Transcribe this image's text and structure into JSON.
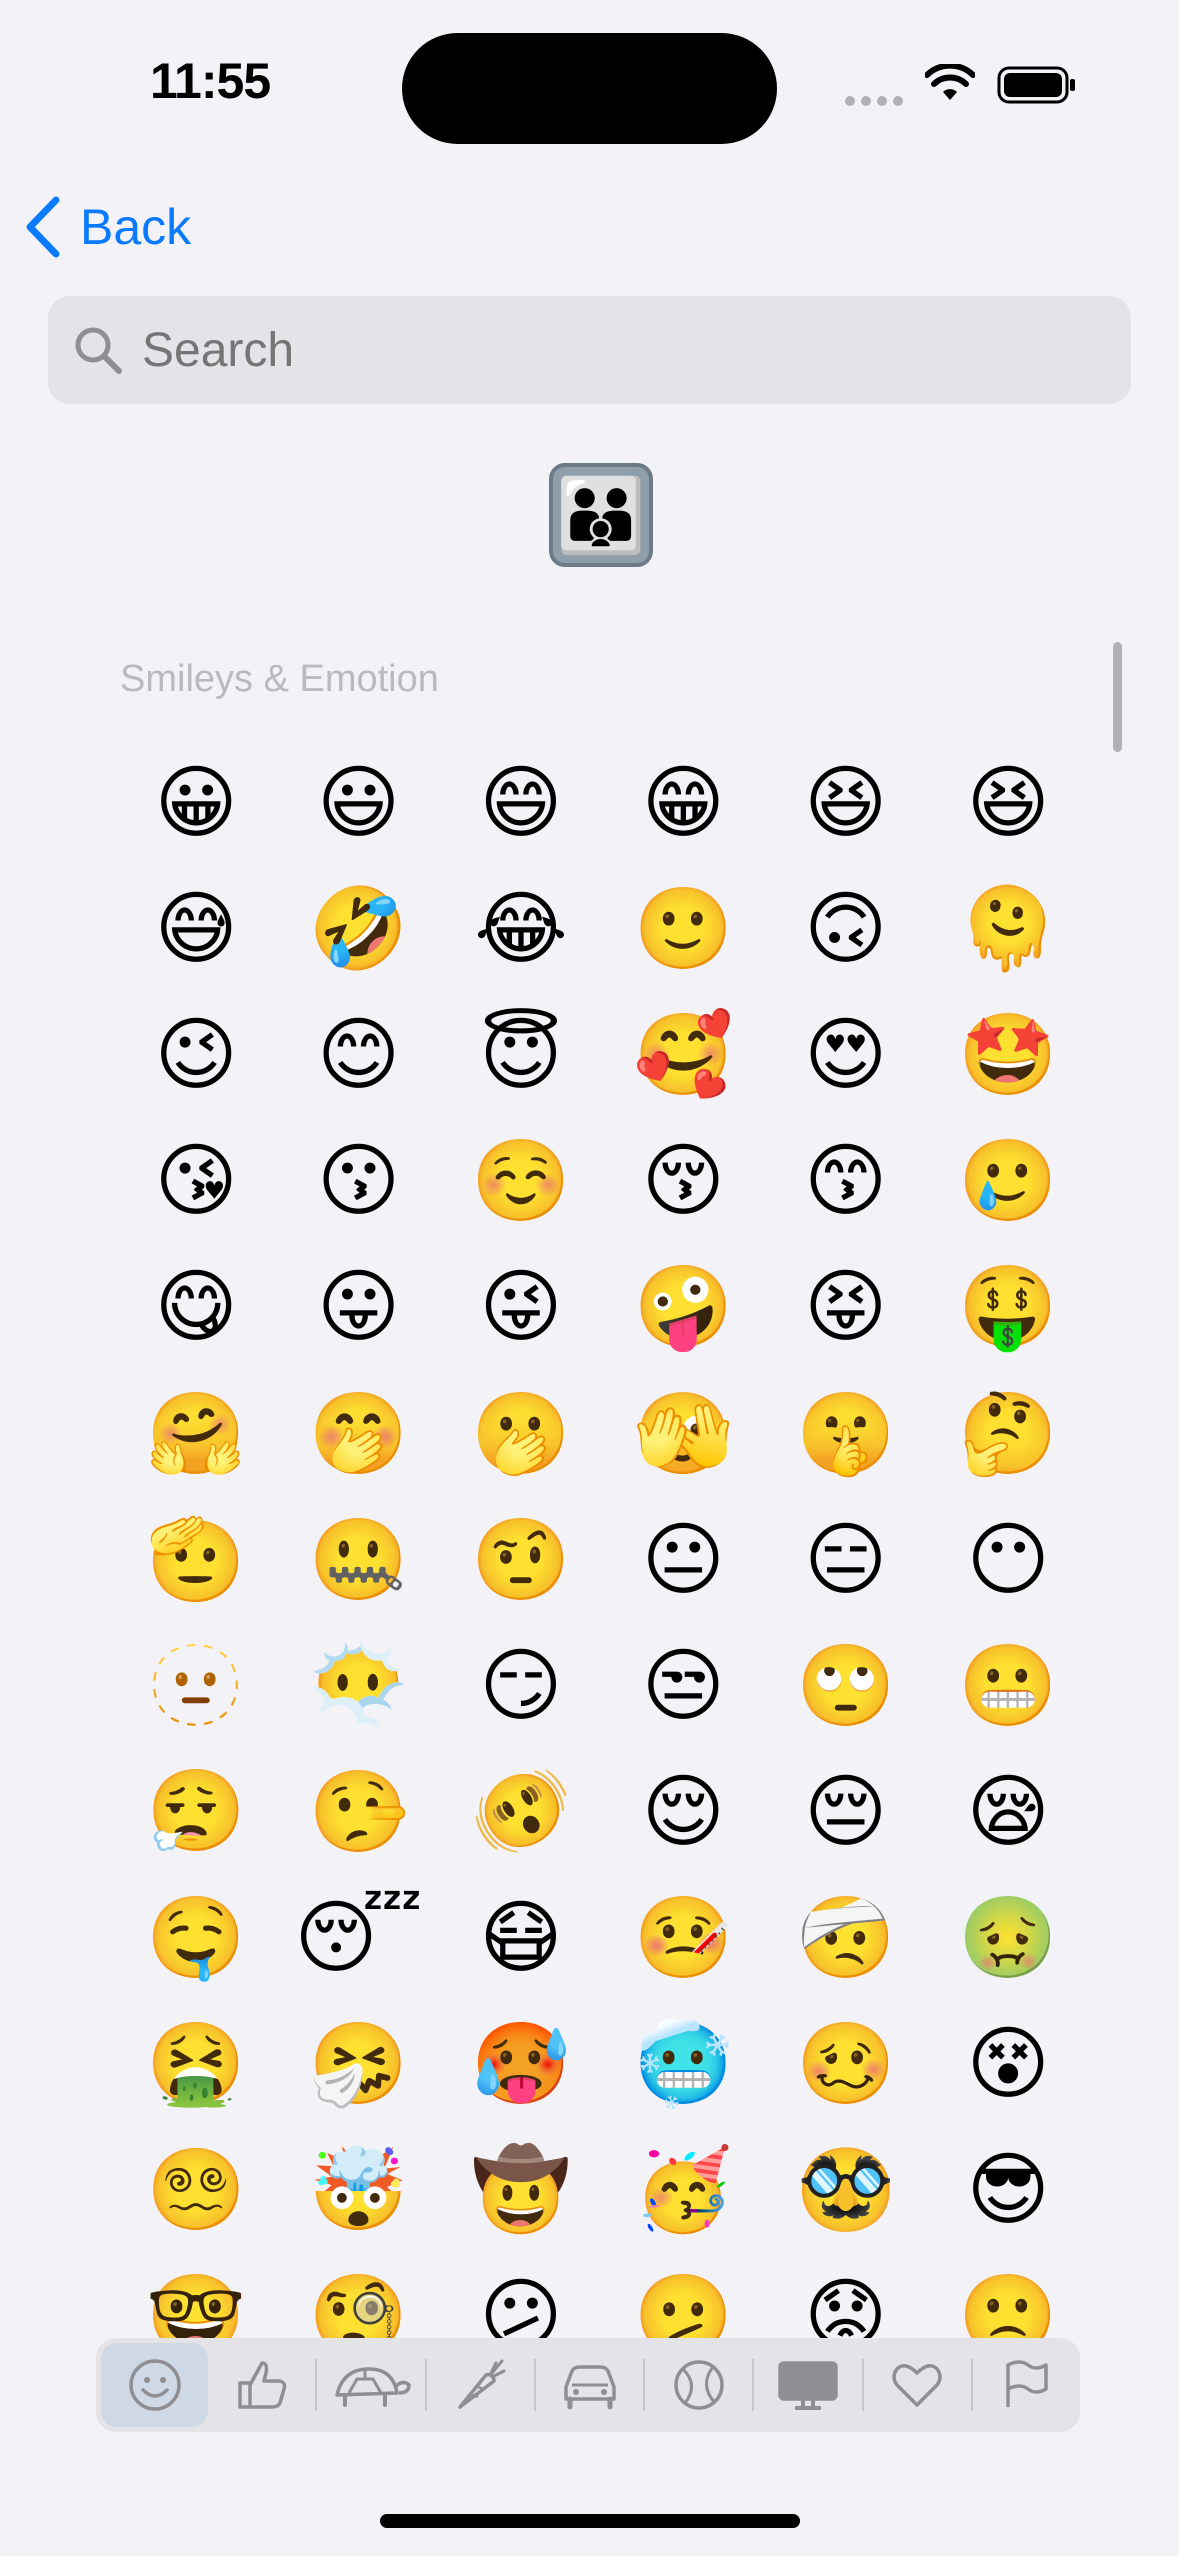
{
  "status_bar": {
    "time": "11:55",
    "icons": [
      "signal-dots-icon",
      "wifi-icon",
      "battery-icon"
    ]
  },
  "nav": {
    "back_label": "Back",
    "back_icon": "chevron-left-icon"
  },
  "search": {
    "placeholder": "Search",
    "value": "",
    "icon": "search-icon"
  },
  "preview": {
    "emoji": "👪"
  },
  "section": {
    "title": "Smileys & Emotion"
  },
  "emojis": [
    "😀",
    "😃",
    "😄",
    "😁",
    "😆",
    "😆",
    "😅",
    "🤣",
    "😂",
    "🙂",
    "🙃",
    "🫠",
    "😉",
    "😊",
    "😇",
    "🥰",
    "😍",
    "🤩",
    "😘",
    "😗",
    "☺️",
    "😚",
    "😙",
    "🥲",
    "😋",
    "😛",
    "😜",
    "🤪",
    "😝",
    "🤑",
    "🤗",
    "🤭",
    "🫢",
    "🫣",
    "🤫",
    "🤔",
    "🫡",
    "🤐",
    "🤨",
    "😐",
    "😑",
    "😶",
    "🫥",
    "😶‍🌫️",
    "😏",
    "😒",
    "🙄",
    "😬",
    "😮‍💨",
    "🤥",
    "🫨",
    "😌",
    "😔",
    "😪",
    "🤤",
    "😴",
    "😷",
    "🤒",
    "🤕",
    "🤢",
    "🤮",
    "🤧",
    "🥵",
    "🥶",
    "🥴",
    "😵",
    "😵‍💫",
    "🤯",
    "🤠",
    "🥳",
    "🥸",
    "😎",
    "🤓",
    "🧐",
    "😕",
    "🫤",
    "😟",
    "🙁"
  ],
  "categories": [
    {
      "name": "smileys",
      "icon": "smiley-icon",
      "active": true
    },
    {
      "name": "people",
      "icon": "thumbs-up-icon",
      "active": false
    },
    {
      "name": "animals",
      "icon": "turtle-icon",
      "active": false
    },
    {
      "name": "food",
      "icon": "carrot-icon",
      "active": false
    },
    {
      "name": "travel",
      "icon": "car-icon",
      "active": false
    },
    {
      "name": "activities",
      "icon": "ball-icon",
      "active": false
    },
    {
      "name": "objects",
      "icon": "computer-icon",
      "active": false
    },
    {
      "name": "symbols",
      "icon": "heart-icon",
      "active": false
    },
    {
      "name": "flags",
      "icon": "flag-icon",
      "active": false
    }
  ],
  "colors": {
    "accent": "#0a7aff",
    "background": "#f2f2f7",
    "search_bg": "#e3e3e8",
    "category_active": "#cfd9e6"
  }
}
